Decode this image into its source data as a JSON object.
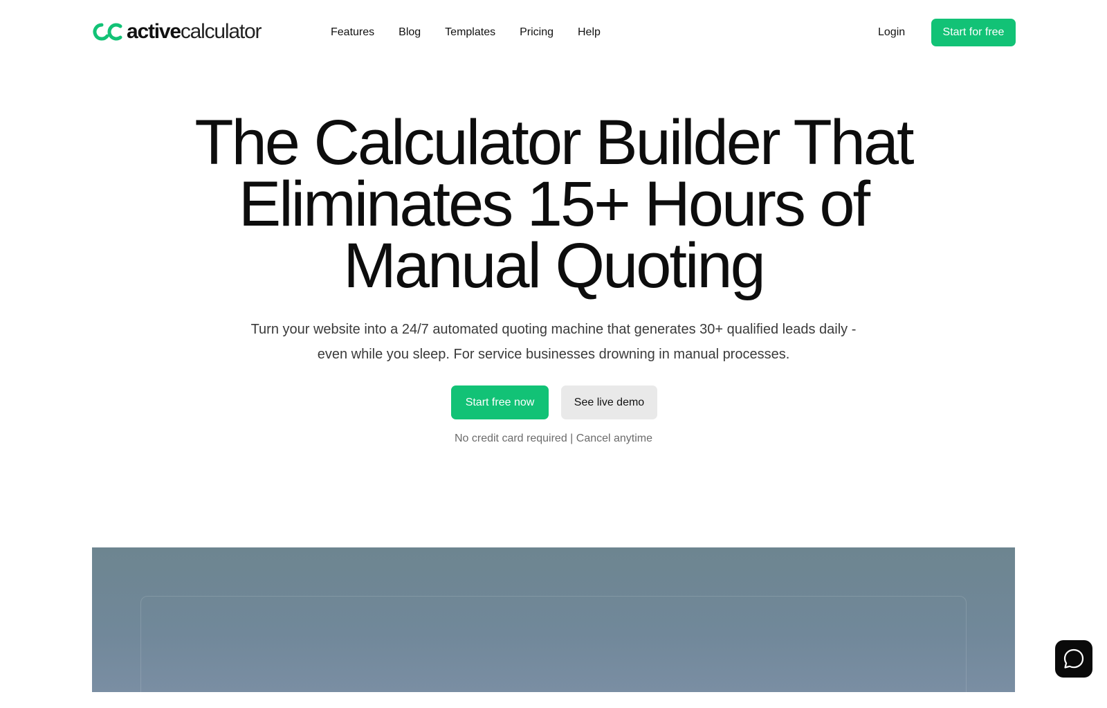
{
  "brand": {
    "name_bold": "active",
    "name_light": "calculator",
    "accent_color": "#12c276",
    "logo_icon": "ac-logo-icon"
  },
  "nav": {
    "links": [
      "Features",
      "Blog",
      "Templates",
      "Pricing",
      "Help"
    ],
    "login_label": "Login",
    "cta_label": "Start for free"
  },
  "hero": {
    "title_lines": [
      "The Calculator Builder That",
      "Eliminates 15+ Hours of",
      "Manual Quoting"
    ],
    "subtitle": "Turn your website into a 24/7 automated quoting machine that generates 30+ qualified leads daily - even while you sleep. For service businesses drowning in manual processes.",
    "primary_cta": "Start free now",
    "secondary_cta": "See live demo",
    "note": "No credit card required | Cancel anytime"
  },
  "preview": {
    "background_color": "#6d8590"
  },
  "chat": {
    "icon": "chat-bubble-icon"
  }
}
